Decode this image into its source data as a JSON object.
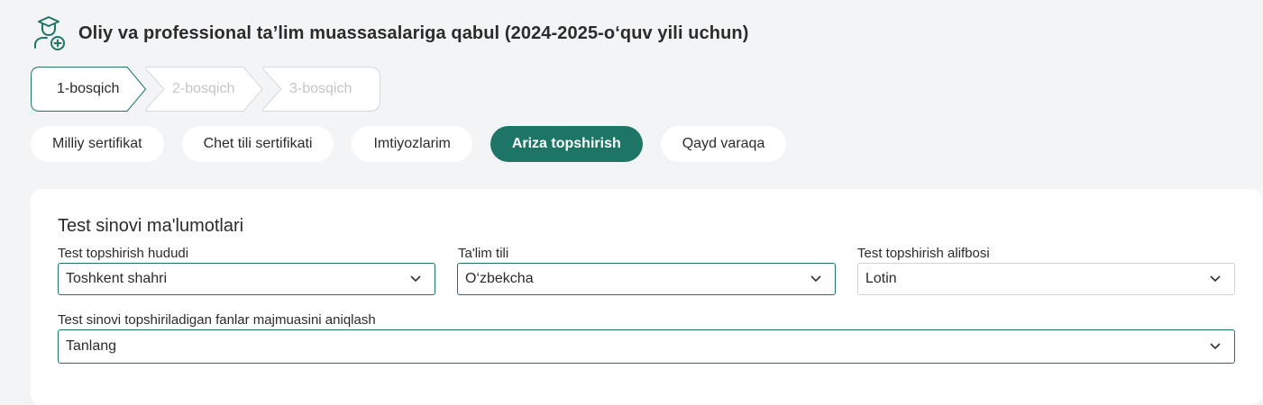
{
  "header": {
    "icon": "graduate-add-icon",
    "title": "Oliy va professional ta’lim muassasalariga qabul (2024-2025-o‘quv yili uchun)"
  },
  "steps": [
    {
      "label": "1-bosqich",
      "state": "active"
    },
    {
      "label": "2-bosqich",
      "state": "inactive"
    },
    {
      "label": "3-bosqich",
      "state": "inactive"
    }
  ],
  "tabs": [
    {
      "label": "Milliy sertifikat",
      "active": false
    },
    {
      "label": "Chet tili sertifikati",
      "active": false
    },
    {
      "label": "Imtiyozlarim",
      "active": false
    },
    {
      "label": "Ariza topshirish",
      "active": true
    },
    {
      "label": "Qayd varaqa",
      "active": false
    }
  ],
  "form": {
    "section_title": "Test sinovi ma'lumotlari",
    "fields": {
      "region": {
        "label": "Test topshirish hududi",
        "value": "Toshkent shahri"
      },
      "language": {
        "label": "Ta'lim tili",
        "value": "O‘zbekcha"
      },
      "alphabet": {
        "label": "Test topshirish alifbosi",
        "value": "Lotin"
      },
      "subjects": {
        "label": "Test sinovi topshiriladigan fanlar majmuasini aniqlash",
        "value": "Tanlang"
      }
    }
  },
  "colors": {
    "accent": "#1d7665",
    "background": "#f3f4f5",
    "inactive_text": "#c3c6c9"
  }
}
